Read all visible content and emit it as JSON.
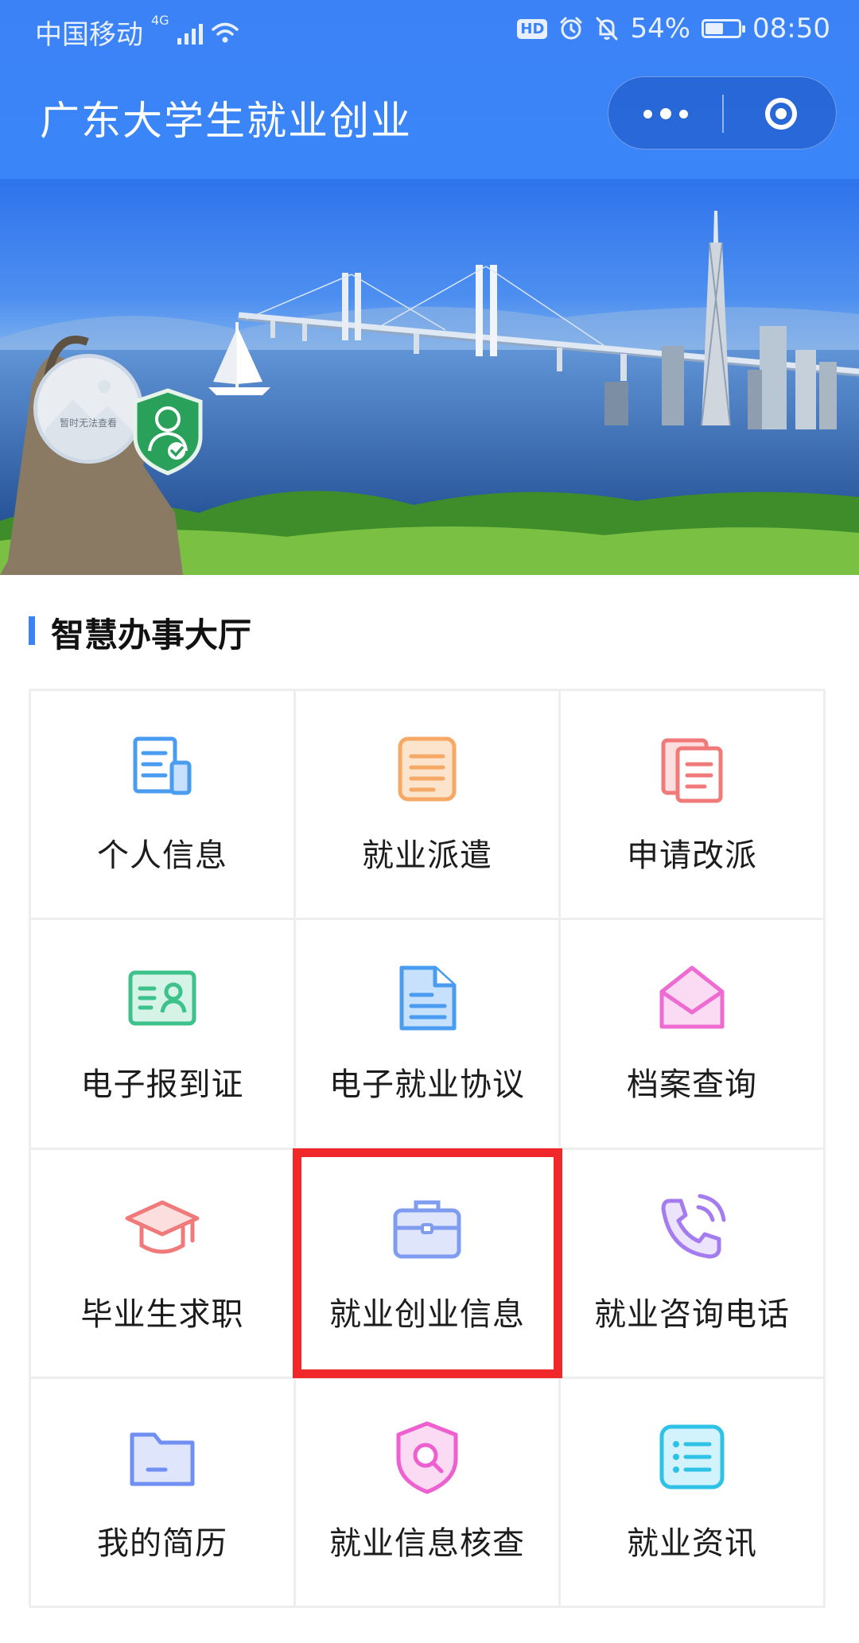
{
  "status_bar": {
    "carrier": "中国移动",
    "network": "4G",
    "hd": "HD",
    "battery": "54%",
    "battery_level": 0.54,
    "time": "08:50"
  },
  "nav": {
    "title": "广东大学生就业创业"
  },
  "profile": {
    "avatar_placeholder": "暂时无法查看"
  },
  "section": {
    "title": "智慧办事大厅"
  },
  "services": [
    {
      "label": "个人信息",
      "icon": "document-icon",
      "color": "#4a9cf0"
    },
    {
      "label": "就业派遣",
      "icon": "clipboard-list-icon",
      "color": "#f5a964"
    },
    {
      "label": "申请改派",
      "icon": "copy-documents-icon",
      "color": "#f07a7a"
    },
    {
      "label": "电子报到证",
      "icon": "id-card-icon",
      "color": "#3cc28a"
    },
    {
      "label": "电子就业协议",
      "icon": "file-icon",
      "color": "#4a9cf0"
    },
    {
      "label": "档案查询",
      "icon": "envelope-open-icon",
      "color": "#ee6bd1"
    },
    {
      "label": "毕业生求职",
      "icon": "graduation-cap-icon",
      "color": "#f07a7a"
    },
    {
      "label": "就业创业信息",
      "icon": "briefcase-icon",
      "color": "#7f9cf0"
    },
    {
      "label": "就业咨询电话",
      "icon": "phone-call-icon",
      "color": "#a47cf0"
    },
    {
      "label": "我的简历",
      "icon": "folder-icon",
      "color": "#6f8ff2"
    },
    {
      "label": "就业信息核查",
      "icon": "shield-search-icon",
      "color": "#ee5fd0"
    },
    {
      "label": "就业资讯",
      "icon": "news-list-icon",
      "color": "#2ec3e6"
    }
  ],
  "highlight_color": "#f0282a"
}
